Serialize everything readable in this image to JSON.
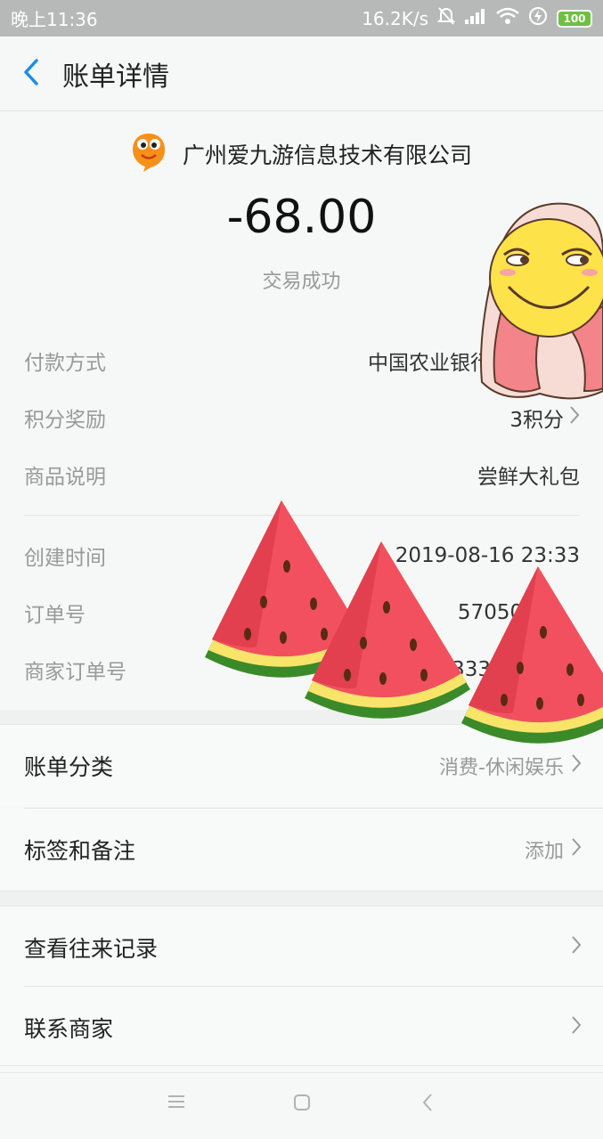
{
  "status_bar": {
    "time": "晚上11:36",
    "net_speed": "16.2K/s",
    "battery": "100",
    "icons": [
      "mute-bell-icon",
      "signal-icon",
      "wifi-icon",
      "charging-icon",
      "battery-icon"
    ]
  },
  "header": {
    "title": "账单详情",
    "back_icon": "chevron-left-icon"
  },
  "merchant": {
    "name": "广州爱九游信息技术有限公司",
    "logo_icon": "orange-mascot-logo"
  },
  "transaction": {
    "amount": "-68.00",
    "status": "交易成功"
  },
  "details": [
    {
      "key": "付款方式",
      "value": "中国农业银行"
    },
    {
      "key": "积分奖励",
      "value": "3积分"
    },
    {
      "key": "商品说明",
      "value": "尝鲜大礼包"
    },
    {
      "key": "创建时间",
      "value": "2019-08-16 23:33"
    },
    {
      "key": "订单号",
      "value": "57050493"
    },
    {
      "key": "商家订单号",
      "value": "333"
    }
  ],
  "section1": [
    {
      "label": "账单分类",
      "value": "消费-休闲娱乐"
    },
    {
      "label": "标签和备注",
      "value": "添加"
    }
  ],
  "section2": [
    {
      "label": "查看往来记录"
    },
    {
      "label": "联系商家"
    }
  ],
  "colors": {
    "accent": "#1a8ee6",
    "status_bar": "#b7b9b8",
    "battery": "#6cc13e",
    "watermelon_flesh": "#f2505f",
    "watermelon_rind": "#3b8a2a"
  }
}
